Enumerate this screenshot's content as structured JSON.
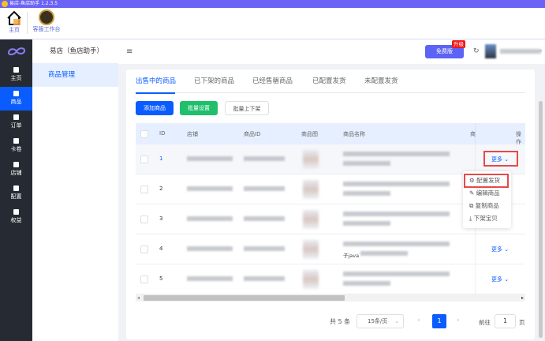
{
  "window": {
    "title": "易店-鱼店助手 1.2.3.5"
  },
  "toolbar": {
    "home": "主页",
    "workbench": "客服工作台"
  },
  "sidebar": {
    "items": [
      {
        "label": "主页"
      },
      {
        "label": "商品"
      },
      {
        "label": "订单"
      },
      {
        "label": "卡卷"
      },
      {
        "label": "店铺"
      },
      {
        "label": "配置"
      },
      {
        "label": "权益"
      }
    ]
  },
  "subnav": {
    "title": "易店（鱼店助手）",
    "item": "商品管理"
  },
  "header": {
    "plan": "免费版",
    "upgrade": "升级"
  },
  "tabs": [
    "出售中的商品",
    "已下架的商品",
    "已经售罄商品",
    "已配置发货",
    "未配置发货"
  ],
  "actions": {
    "add": "添加商品",
    "batch_set": "批量设置",
    "batch_shelf": "批量上下架"
  },
  "table": {
    "columns": [
      "ID",
      "店铺",
      "商品ID",
      "商品图",
      "商品名称",
      "商",
      "操作"
    ],
    "rows": [
      {
        "id": "1",
        "extra": ""
      },
      {
        "id": "2",
        "extra": ""
      },
      {
        "id": "3",
        "extra": ""
      },
      {
        "id": "4",
        "extra": "子java"
      },
      {
        "id": "5",
        "extra": ""
      }
    ],
    "more": "更多"
  },
  "menu": [
    "配置发货",
    "编辑商品",
    "复制商品",
    "下架宝贝"
  ],
  "pagination": {
    "total": "共 5 条",
    "page_size": "15条/页",
    "current": "1",
    "goto": "前往",
    "goto_value": "1",
    "page_suffix": "页"
  },
  "colors": {
    "accent": "#0a5cff",
    "titlebar": "#6b63f5",
    "green": "#1fbf6b",
    "highlight": "#e84848"
  }
}
